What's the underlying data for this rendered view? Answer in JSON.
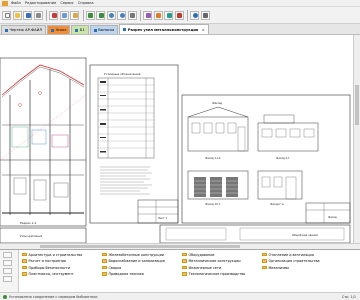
{
  "menu": [
    "Файл",
    "Редактирование",
    "Сервис",
    "Справка"
  ],
  "tabs": [
    {
      "label": "Чертеж АР-ФАЙЛ",
      "style": "normal"
    },
    {
      "label": "Эскиз",
      "style": "orange"
    },
    {
      "label": "Б1",
      "style": "green"
    },
    {
      "label": "Выноска",
      "style": "blue"
    },
    {
      "label": "Разрез узел металлоконструкция",
      "style": "active",
      "close": "×"
    }
  ],
  "sheets": {
    "left_title": "Разрез 1-1",
    "mid_table_title": "Условные обозначения",
    "mid_stamp": "Лист 1",
    "right_title": "Фасад",
    "view_labels": [
      "Фасад 1-10",
      "Фасад А-Г",
      "Фасад 10-1",
      "Фасад Г-А"
    ],
    "bottom_title": "Узлы крепления",
    "right_stamp": "Фасад",
    "bottom_right_stamp": "Общий вид здания"
  },
  "library": {
    "items": [
      "Архитектура и строительство",
      "Железобетонные конструкции",
      "Оборудование",
      "Отопление и вентиляция",
      "Расчет и построения",
      "Водоснабжение и канализация",
      "Металлические конструкции",
      "Организация строительства",
      "Приборы безопасности",
      "Сварка",
      "Инженерные сети",
      "Механизмы",
      "Пластмассы, инструмент",
      "Приводная техника",
      "Технологическое производство"
    ]
  },
  "status": {
    "text": "Установлено соединение с сервером библиотеки",
    "count_label": "Стр. 1/1"
  }
}
